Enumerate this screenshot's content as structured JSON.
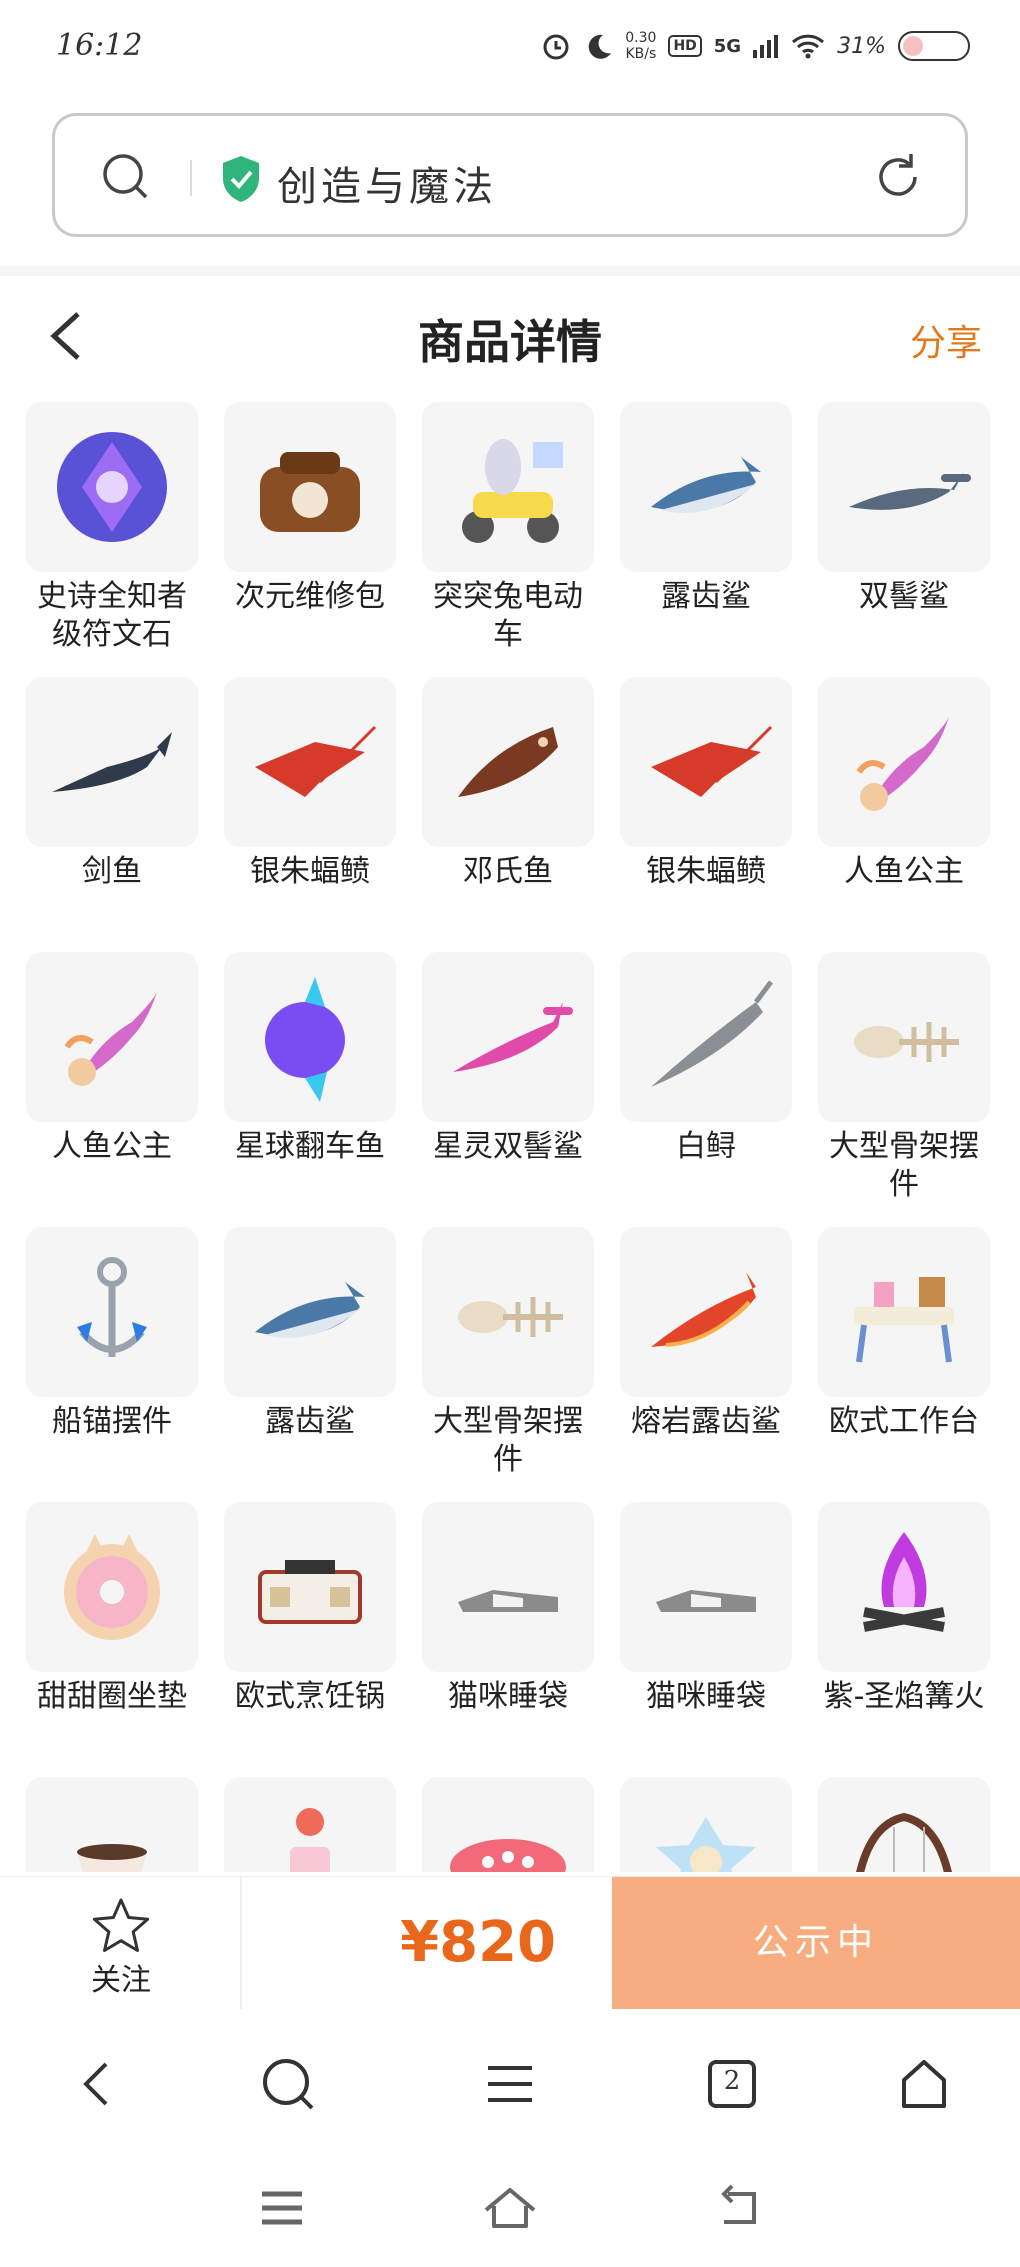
{
  "status_bar": {
    "time": "16:12",
    "net_speed_value": "0.30",
    "net_speed_unit": "KB/s",
    "hd_label": "HD",
    "network": "5G",
    "battery": "31%"
  },
  "url_bar": {
    "site_name": "创造与魔法",
    "icons": [
      "search-icon",
      "shield-check-icon",
      "refresh-icon"
    ]
  },
  "header": {
    "title": "商品详情",
    "share_label": "分享"
  },
  "items": [
    {
      "name": "史诗全知者级符文石",
      "icon": "rune-stone"
    },
    {
      "name": "次元维修包",
      "icon": "repair-bag"
    },
    {
      "name": "突突兔电动车",
      "icon": "bunny-scooter"
    },
    {
      "name": "露齿鲨",
      "icon": "shark"
    },
    {
      "name": "双髻鲨",
      "icon": "hammerhead-shark"
    },
    {
      "name": "剑鱼",
      "icon": "swordfish"
    },
    {
      "name": "银朱蝠鲼",
      "icon": "manta-ray"
    },
    {
      "name": "邓氏鱼",
      "icon": "dunkleosteus"
    },
    {
      "name": "银朱蝠鲼",
      "icon": "manta-ray"
    },
    {
      "name": "人鱼公主",
      "icon": "mermaid"
    },
    {
      "name": "人鱼公主",
      "icon": "mermaid"
    },
    {
      "name": "星球翻车鱼",
      "icon": "sunfish"
    },
    {
      "name": "星灵双髻鲨",
      "icon": "pink-hammerhead"
    },
    {
      "name": "白鲟",
      "icon": "paddlefish"
    },
    {
      "name": "大型骨架摆件",
      "icon": "skeleton"
    },
    {
      "name": "船锚摆件",
      "icon": "anchor"
    },
    {
      "name": "露齿鲨",
      "icon": "shark"
    },
    {
      "name": "大型骨架摆件",
      "icon": "skeleton"
    },
    {
      "name": "熔岩露齿鲨",
      "icon": "lava-shark"
    },
    {
      "name": "欧式工作台",
      "icon": "workbench"
    },
    {
      "name": "甜甜圈坐垫",
      "icon": "donut-cushion"
    },
    {
      "name": "欧式烹饪锅",
      "icon": "cooking-stove"
    },
    {
      "name": "猫咪睡袋",
      "icon": "cat-sleeping-bag"
    },
    {
      "name": "猫咪睡袋",
      "icon": "cat-sleeping-bag"
    },
    {
      "name": "紫-圣焰篝火",
      "icon": "purple-bonfire"
    },
    {
      "name": "",
      "icon": "teacup"
    },
    {
      "name": "",
      "icon": "cake"
    },
    {
      "name": "",
      "icon": "red-cake"
    },
    {
      "name": "",
      "icon": "star-cushion"
    },
    {
      "name": "",
      "icon": "swing"
    }
  ],
  "purchase_bar": {
    "follow_label": "关注",
    "price": "¥820",
    "status_label": "公示中"
  },
  "colors": {
    "accent_orange": "#e8671b",
    "status_button": "#f8ad80",
    "share_orange": "#e07a1f",
    "shield_green": "#2fb47c"
  },
  "browser_nav": [
    "back-icon",
    "search-icon",
    "menu-icon",
    "tabs-icon",
    "home-icon"
  ],
  "browser_nav_tab_count": "2",
  "system_nav": [
    "recents-icon",
    "home-icon",
    "back-icon"
  ]
}
